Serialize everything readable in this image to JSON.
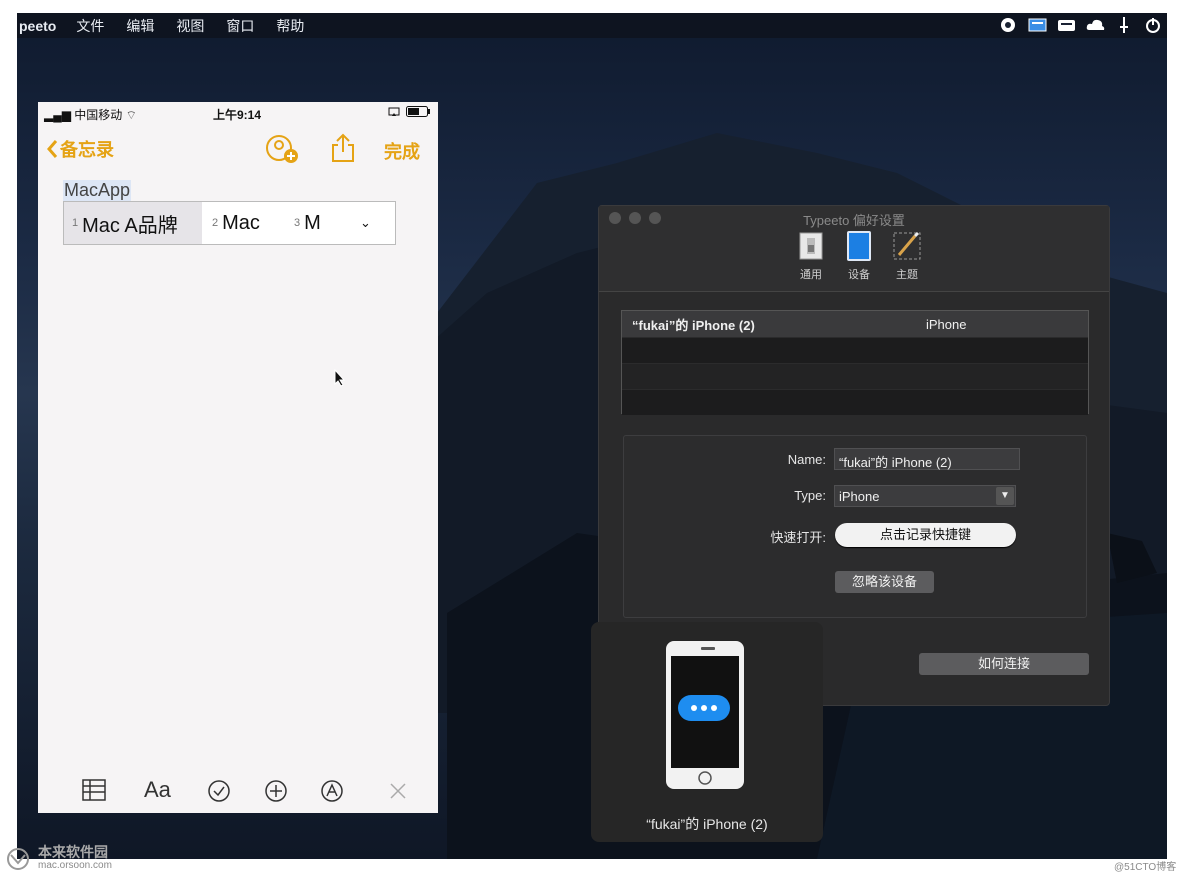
{
  "menubar": {
    "app_name": "peeto",
    "items": [
      "文件",
      "编辑",
      "视图",
      "窗口",
      "帮助"
    ]
  },
  "phone": {
    "carrier": "中国移动",
    "time": "上午9:14",
    "back_label": "备忘录",
    "done_label": "完成",
    "note_text": "MacApp",
    "candidates": [
      {
        "index": "1",
        "text": "Mac A品牌"
      },
      {
        "index": "2",
        "text": "Mac"
      },
      {
        "index": "3",
        "text": "M"
      }
    ],
    "toolbar": {
      "format_label": "Aa"
    }
  },
  "prefs": {
    "title": "Typeeto 偏好设置",
    "tabs": [
      "通用",
      "设备",
      "主题"
    ],
    "table": {
      "rows": [
        {
          "name": "“fukai”的 iPhone (2)",
          "type": "iPhone"
        }
      ]
    },
    "form": {
      "name_label": "Name:",
      "name_value": "“fukai”的 iPhone (2)",
      "type_label": "Type:",
      "type_value": "iPhone",
      "shortcut_label": "快速打开:",
      "shortcut_button": "点击记录快捷键",
      "ignore_button": "忽略该设备"
    },
    "how_to_connect": "如何连接"
  },
  "device_card": {
    "name": "“fukai”的 iPhone (2)"
  },
  "watermarks": {
    "site_name": "本来软件园",
    "site_url": "mac.orsoon.com",
    "corner": "@51CTO博客"
  }
}
